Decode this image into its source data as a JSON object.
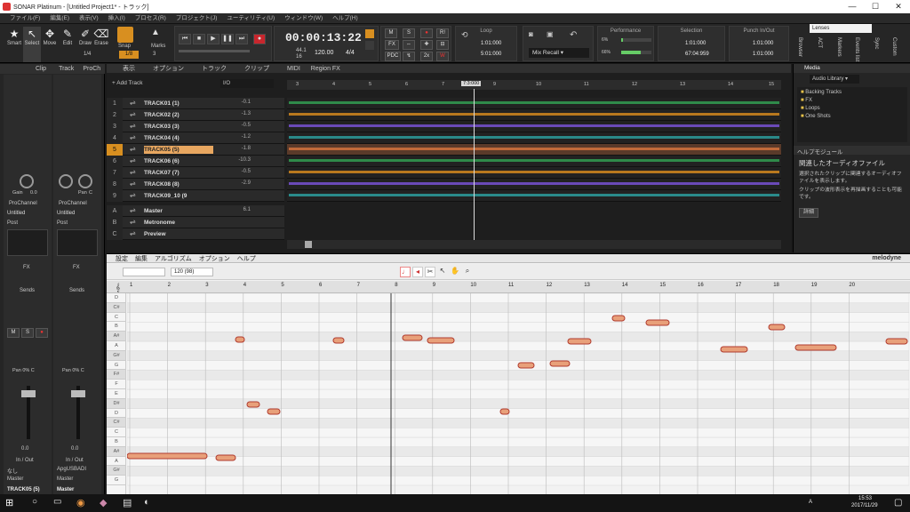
{
  "window": {
    "title": "SONAR Platinum - [Untitled Project1* - トラック]",
    "min": "—",
    "max": "☐",
    "close": "✕"
  },
  "menu": [
    "ファイル(F)",
    "編集(E)",
    "表示(V)",
    "挿入(I)",
    "プロセス(R)",
    "プロジェクト(J)",
    "ユーティリティ(U)",
    "ウィンドウ(W)",
    "ヘルプ(H)"
  ],
  "tools": [
    {
      "label": "Smart",
      "icon": "★"
    },
    {
      "label": "Select",
      "icon": "↖"
    },
    {
      "label": "Move",
      "icon": "✥"
    },
    {
      "label": "Edit",
      "icon": "✎"
    },
    {
      "label": "Draw",
      "icon": "✐"
    },
    {
      "label": "Erase",
      "icon": "⌫"
    }
  ],
  "snap": {
    "label": "Snap",
    "value": "1/8",
    "page": "1/4",
    "marks": "Marks",
    "marks_val": "3"
  },
  "transport": {
    "time": "00:00:13:22",
    "tempo": "120.00",
    "meter": "4/4",
    "tempo_top": "44.1",
    "tempo_bottom": "16"
  },
  "mix": {
    "m": "M",
    "s": "S",
    "fx": "FX",
    "pdc": "PDC",
    "x2": "2x",
    "w": "W",
    "r": "R!"
  },
  "loop": {
    "title": "Loop",
    "start": "1:01:000",
    "end": "5:01:000"
  },
  "mixrecall": {
    "label": "Mix Recall"
  },
  "performance": {
    "title": "Performance",
    "a": "6%",
    "b": "66%",
    "c": "86%"
  },
  "selection": {
    "title": "Selection",
    "start": "1:01:000",
    "end": "67:04:959"
  },
  "punch": {
    "title": "Punch In/Out",
    "start": "1:01:000",
    "end": "1:01:000"
  },
  "workspace": {
    "name": "Lenses"
  },
  "rightTabs": [
    "Browser",
    "ACT",
    "Markers",
    "Events list",
    "Sync",
    "Custom"
  ],
  "inspector": {
    "tabs": [
      "Clip",
      "Track",
      "ProCh"
    ],
    "gain_label": "Gain",
    "gain_val": "0.0",
    "pan_label": "Pan",
    "pan_val": "C",
    "prochannel": "ProChannel",
    "untitled": "Untitled",
    "post": "Post",
    "fx": "FX",
    "sends": "Sends",
    "pan_pct": "Pan 0% C",
    "db_val": "0.0",
    "inout": "In / Out",
    "in_a": "なし",
    "in_b": "ApgUSBADI",
    "out_a": "Master",
    "out_b": "Master",
    "track_name": "TRACK05 (5)",
    "track_num": "5",
    "master_name": "Master",
    "master_letter": "A",
    "scale": [
      "6",
      "0",
      "-6",
      "-12",
      "-18",
      "-24",
      "-30",
      "-36",
      "-42",
      "-48",
      "-54"
    ]
  },
  "trackview": {
    "menus": [
      "表示",
      "オプション",
      "トラック",
      "クリップ",
      "MIDI",
      "Region FX"
    ],
    "add_track": "+ Add Track",
    "io": "I/O",
    "ruler": [
      "3",
      "4",
      "5",
      "6",
      "7",
      "7:3:000",
      "9",
      "10",
      "11",
      "12",
      "13",
      "14",
      "15"
    ],
    "tracks": [
      {
        "num": "1",
        "name": "TRACK01 (1)",
        "vol": "-0.1",
        "color": "#2f8a4a"
      },
      {
        "num": "2",
        "name": "TRACK02 (2)",
        "vol": "-1.3",
        "color": "#b8781e"
      },
      {
        "num": "3",
        "name": "TRACK03 (3)",
        "vol": "-0.5",
        "color": "#6a4ab8"
      },
      {
        "num": "4",
        "name": "TRACK04 (4)",
        "vol": "-1.2",
        "color": "#2a8a8a"
      },
      {
        "num": "5",
        "name": "TRACK05 (5)",
        "vol": "-1.8",
        "color": "#c06a3a"
      },
      {
        "num": "6",
        "name": "TRACK06 (6)",
        "vol": "-10.3",
        "color": "#2f8a4a"
      },
      {
        "num": "7",
        "name": "TRACK07 (7)",
        "vol": "-0.5",
        "color": "#b8781e"
      },
      {
        "num": "8",
        "name": "TRACK08 (8)",
        "vol": "-2.9",
        "color": "#6a4ab8"
      },
      {
        "num": "9",
        "name": "TRACK09_10 (9",
        "vol": "",
        "color": "#2a8a8a"
      }
    ],
    "buses": [
      {
        "letter": "A",
        "name": "Master",
        "vol": "6.1"
      },
      {
        "letter": "B",
        "name": "Metronome",
        "vol": ""
      },
      {
        "letter": "C",
        "name": "Preview",
        "vol": ""
      }
    ]
  },
  "browser": {
    "tab": "Media",
    "library": "Audio Library",
    "folders": [
      "Backing Tracks",
      "FX",
      "Loops",
      "One Shots"
    ],
    "help_title": "ヘルプモジュール",
    "help_heading": "関連したオーディオファイル",
    "help_text1": "選択されたクリップに関連するオーディオファイルを表示します。",
    "help_text2": "クリップの波形表示を再描画することも可能です。",
    "detail": "詳細"
  },
  "melodyne": {
    "menus": [
      "設定",
      "編集",
      "アルゴリズム",
      "オプション",
      "ヘルプ"
    ],
    "brand": "melodyne",
    "brand_sub": "essential",
    "tempo": "120 (98)",
    "bars": [
      "1",
      "2",
      "3",
      "4",
      "5",
      "6",
      "7",
      "8",
      "9",
      "10",
      "11",
      "12",
      "13",
      "14",
      "15",
      "16",
      "17",
      "18",
      "19",
      "20"
    ],
    "notes": [
      "D",
      "C#",
      "C",
      "B",
      "A#",
      "A",
      "G#",
      "G",
      "F#",
      "F",
      "E",
      "D#",
      "D",
      "C#",
      "C",
      "B",
      "A#",
      "A",
      "G#",
      "G"
    ]
  },
  "taskbar": {
    "time": "15:53",
    "date": "2017/11/29",
    "ime": "A"
  }
}
